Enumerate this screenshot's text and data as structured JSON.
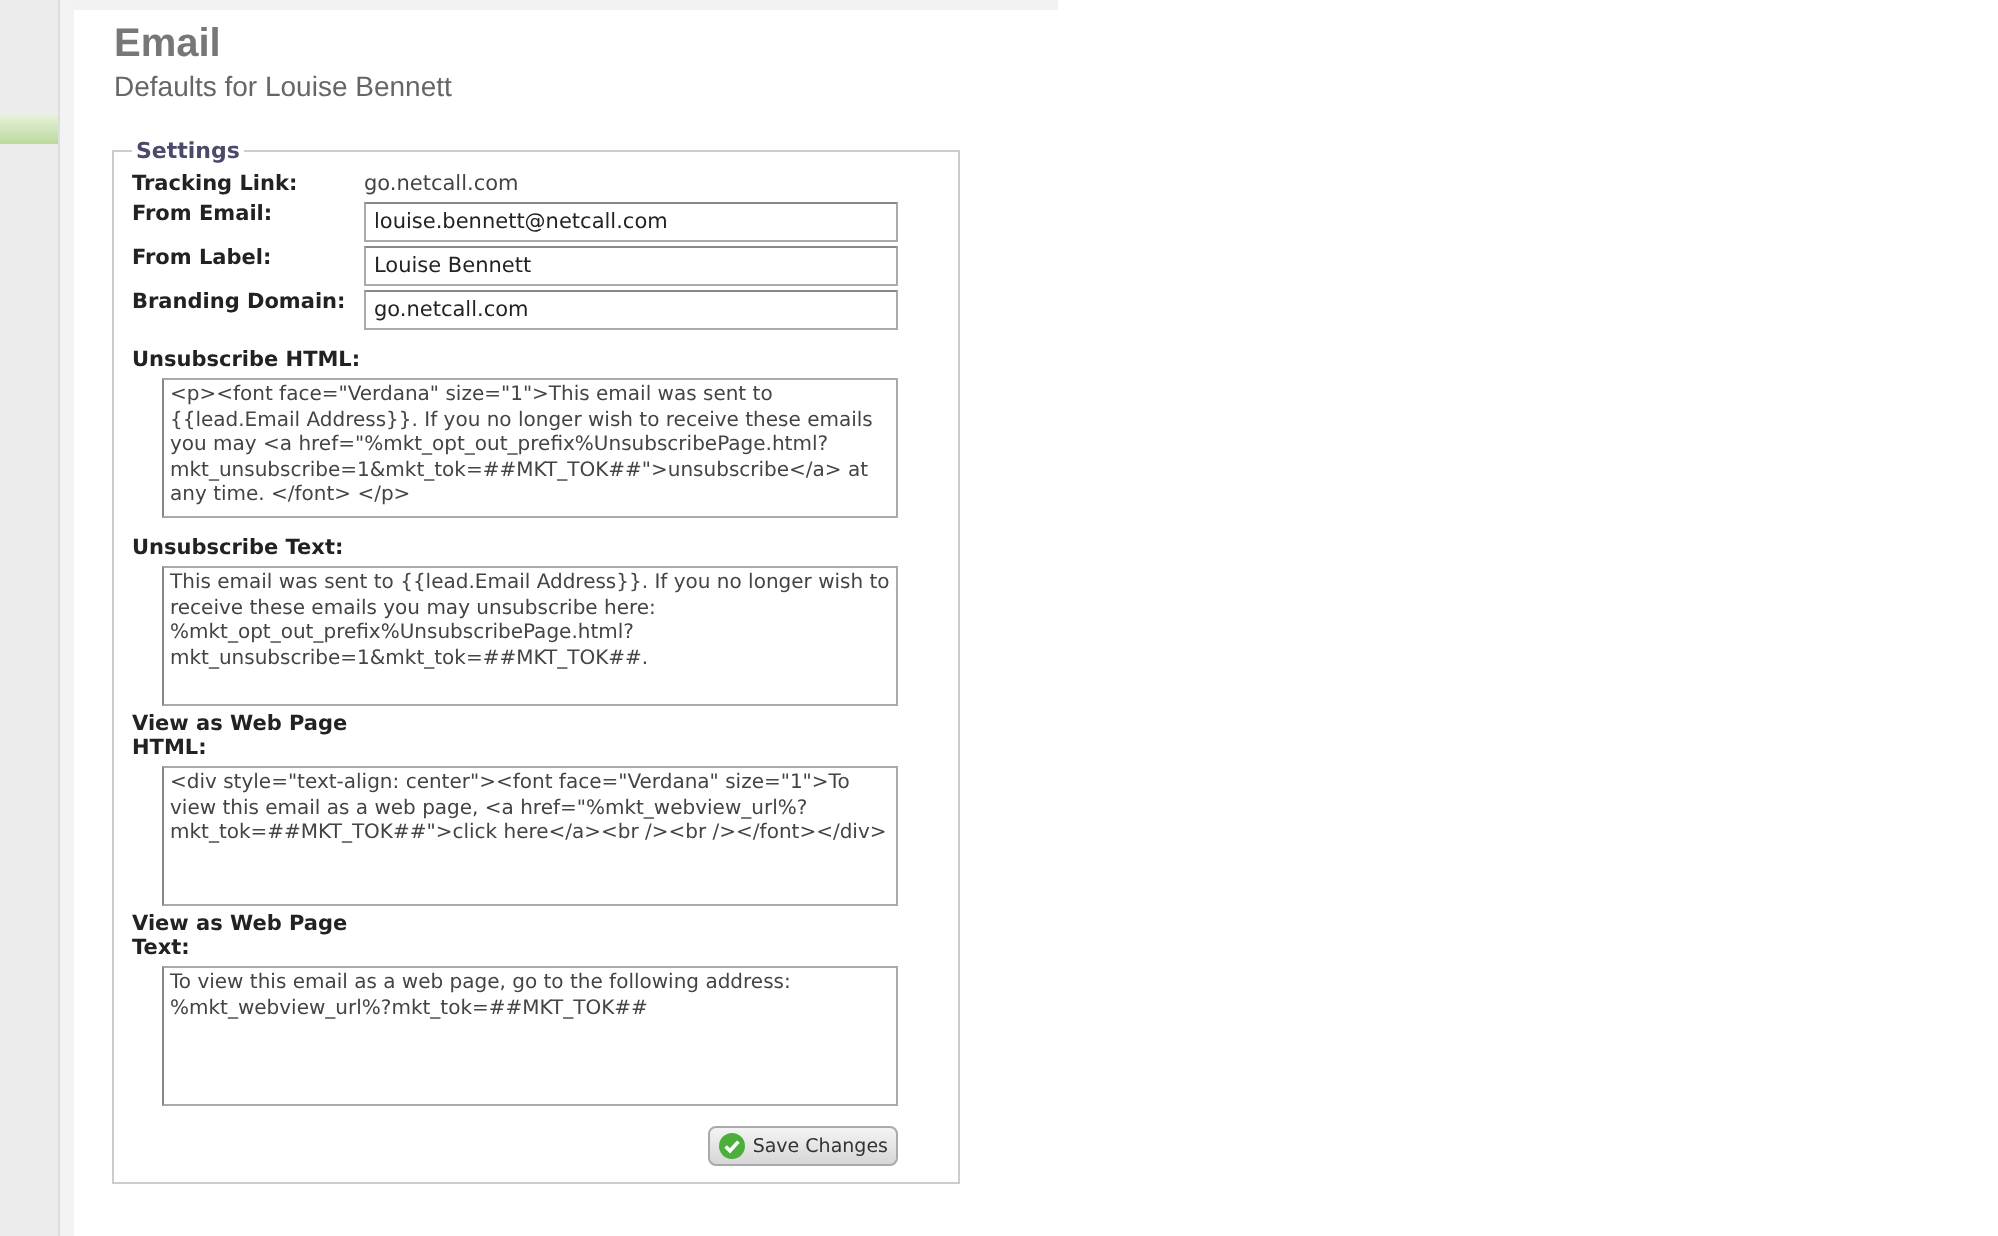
{
  "header": {
    "title": "Email",
    "subtitle": "Defaults for Louise Bennett"
  },
  "settings": {
    "legend": "Settings",
    "fields": [
      {
        "kind": "static",
        "label": "Tracking Link:",
        "value": "go.netcall.com"
      },
      {
        "kind": "input",
        "label": "From Email:",
        "value": "louise.bennett@netcall.com"
      },
      {
        "kind": "input",
        "label": "From Label:",
        "value": "Louise Bennett"
      },
      {
        "kind": "input",
        "label": "Branding Domain:",
        "value": "go.netcall.com"
      },
      {
        "kind": "textarea",
        "label": "Unsubscribe HTML:",
        "value": "<p><font face=\"Verdana\" size=\"1\">This email was sent to {{lead.Email Address}}. If you no longer wish to receive these emails you may <a href=\"%mkt_opt_out_prefix%UnsubscribePage.html?mkt_unsubscribe=1&mkt_tok=##MKT_TOK##\">unsubscribe</a> at any time. </font> </p>"
      },
      {
        "kind": "textarea",
        "label": "Unsubscribe Text:",
        "value": "This email was sent to {{lead.Email Address}}. If you no longer wish to receive these emails you may unsubscribe here: %mkt_opt_out_prefix%UnsubscribePage.html?mkt_unsubscribe=1&mkt_tok=##MKT_TOK##."
      },
      {
        "kind": "textarea",
        "label": "View as Web Page HTML:",
        "value": "<div style=\"text-align: center\"><font face=\"Verdana\" size=\"1\">To view this email as a web page, <a href=\"%mkt_webview_url%?mkt_tok=##MKT_TOK##\">click here</a><br /><br /></font></div>"
      },
      {
        "kind": "textarea",
        "label": "View as Web Page Text:",
        "value": "To view this email as a web page, go to the following address: %mkt_webview_url%?mkt_tok=##MKT_TOK##"
      }
    ],
    "save_button": "Save Changes"
  }
}
